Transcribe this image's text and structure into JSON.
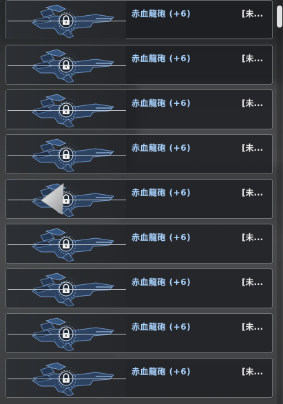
{
  "items": [
    {
      "name": "赤血龍砲 (+6)",
      "status": "[未..."
    },
    {
      "name": "赤血龍砲 (+6)",
      "status": "[未..."
    },
    {
      "name": "赤血龍砲 (+6)",
      "status": "[未..."
    },
    {
      "name": "赤血龍砲 (+6)",
      "status": "[未..."
    },
    {
      "name": "赤血龍砲 (+6)",
      "status": "[未..."
    },
    {
      "name": "赤血龍砲 (+6)",
      "status": "[未..."
    },
    {
      "name": "赤血龍砲 (+6)",
      "status": "[未..."
    },
    {
      "name": "赤血龍砲 (+6)",
      "status": "[未..."
    },
    {
      "name": "赤血龍砲 (+6)",
      "status": "[未..."
    }
  ],
  "icons": {
    "weapon": "dragon-cannon-icon",
    "lock": "lock-icon",
    "cursor": "cursor-icon"
  },
  "colors": {
    "item_name": "#a9d3ff",
    "status_text": "#e8e8e8",
    "border": "#afb2b6"
  }
}
